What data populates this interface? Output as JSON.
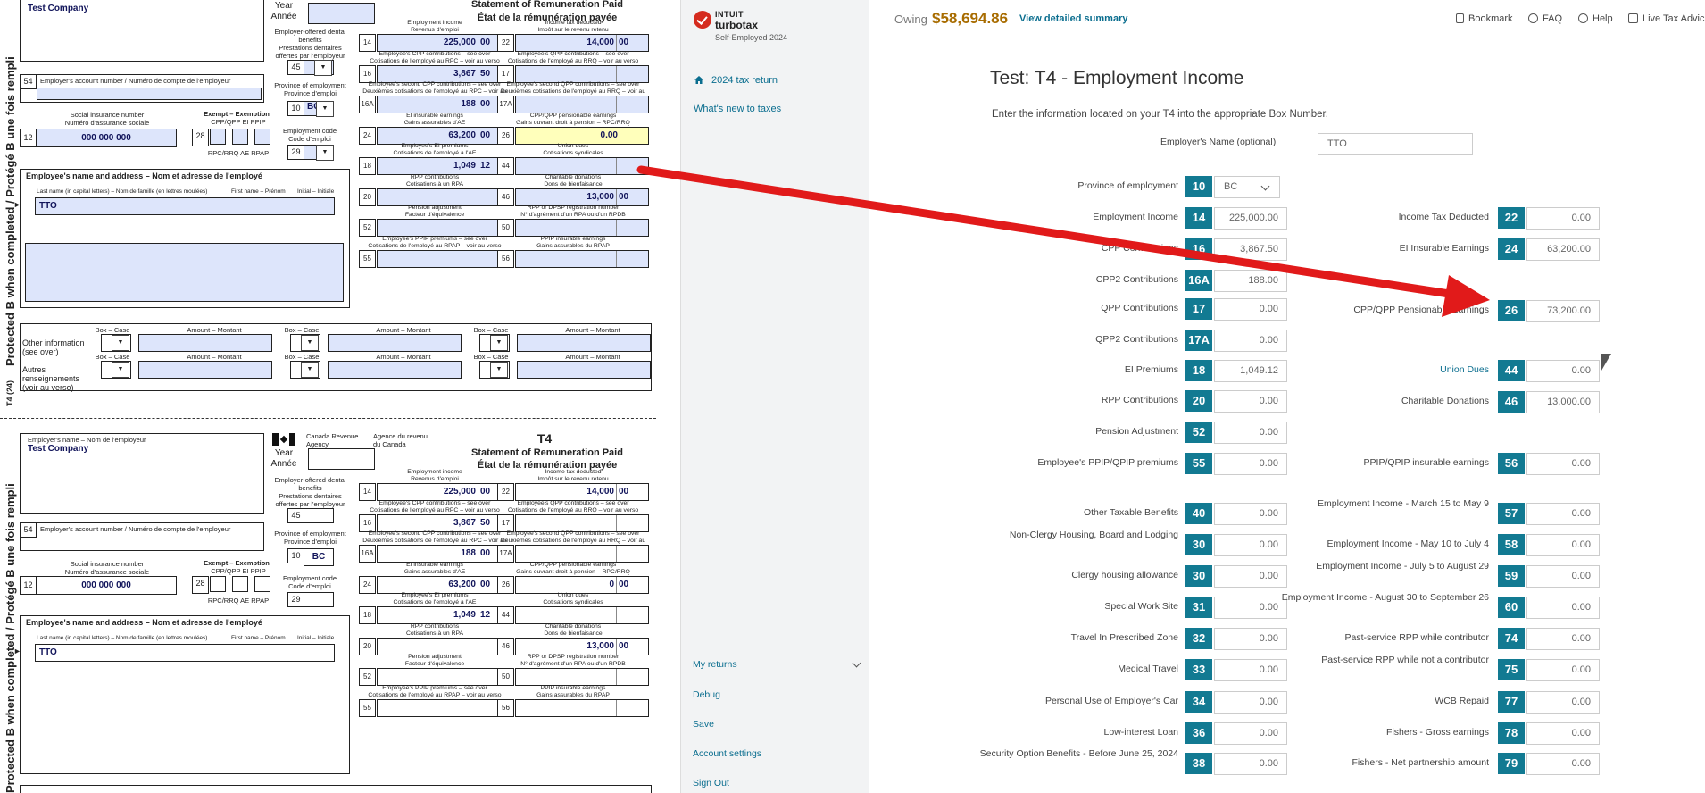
{
  "form": {
    "side_text_1": "Protected B when completed / Protégé B une fois rempli",
    "side_text_2": "T4 (24)",
    "side_text_3": "Protected B when completed / Protégé B une fois rempli",
    "employer_name": "Test Company",
    "employer_name_label": "Employer's name – Nom de l'employeur",
    "year_label": "Year\nAnnée",
    "statement_en": "Statement of Remuneration Paid",
    "statement_fr": "État de la rémunération payée",
    "cra_en": "Canada Revenue Agency",
    "cra_fr": "Agence du revenu du Canada",
    "t4": "T4",
    "dental_label": "Employer-offered dental benefits\nPrestations dentaires offertes par l'employeur",
    "box45": "45",
    "account_label": "Employer's account number / Numéro de compte de l'employeur",
    "box54": "54",
    "province_label": "Province of employment\nProvince d'emploi",
    "box10": "10",
    "province_value": "BC",
    "sin_label": "Social insurance number\nNuméro d'assurance sociale",
    "box12": "12",
    "sin_value": "000 000 000",
    "exempt_label": "Exempt – Exemption",
    "exempt_cols": "CPP/QPP   EI    PPIP",
    "exempt_cols_fr": "RPC/RRQ  AE   RPAP",
    "box28": "28",
    "empcode_label": "Employment code\nCode d'emploi",
    "box29": "29",
    "employee_label": "Employee's name and address – Nom et adresse de l'employé",
    "lastname_label": "Last name (in capital letters) – Nom de famille (en lettres moulées)",
    "firstname_label": "First name – Prénom",
    "initial_label": "Initial – Initiale",
    "employee_name": "TTO",
    "other_info_label": "Other information (see over)",
    "other_info_label_fr": "Autres renseignements (voir au verso)",
    "box_case": "Box – Case",
    "amount_label": "Amount – Montant",
    "boxes_left": [
      {
        "num": "14",
        "label": "Employment income\nRevenus d'emploi",
        "value": "225,000",
        "cents": "00"
      },
      {
        "num": "16",
        "label": "Employee's CPP contributions – see over\nCotisations de l'employé au RPC – voir au verso",
        "value": "3,867",
        "cents": "50"
      },
      {
        "num": "16A",
        "label": "Employee's second CPP contributions – see over\nDeuxièmes cotisations de l'employé au RPC – voir au verso",
        "value": "188",
        "cents": "00"
      },
      {
        "num": "24",
        "label": "EI insurable earnings\nGains assurables d'AE",
        "value": "63,200",
        "cents": "00"
      },
      {
        "num": "18",
        "label": "Employee's EI premiums\nCotisations de l'employé à l'AE",
        "value": "1,049",
        "cents": "12"
      },
      {
        "num": "20",
        "label": "RPP contributions\nCotisations à un RPA",
        "value": "",
        "cents": ""
      },
      {
        "num": "52",
        "label": "Pension adjustment\nFacteur d'équivalence",
        "value": "",
        "cents": ""
      },
      {
        "num": "55",
        "label": "Employee's PPIP premiums – see over\nCotisations de l'employé au RPAP – voir au verso",
        "value": "",
        "cents": ""
      }
    ],
    "boxes_right": [
      {
        "num": "22",
        "label": "Income tax deducted\nImpôt sur le revenu retenu",
        "value": "14,000",
        "cents": "00"
      },
      {
        "num": "17",
        "label": "Employee's QPP contributions – see over\nCotisations de l'employé au RRQ – voir au verso",
        "value": "",
        "cents": ""
      },
      {
        "num": "17A",
        "label": "Employee's second QPP contributions – see over\nDeuxièmes cotisations de l'employé au RRQ – voir au verso",
        "value": "",
        "cents": ""
      },
      {
        "num": "26",
        "label": "CPP/QPP pensionable earnings\nGains ouvrant droit à pension – RPC/RRQ",
        "value": "0",
        "cents": "00"
      },
      {
        "num": "44",
        "label": "Union dues\nCotisations syndicales",
        "value": "",
        "cents": ""
      },
      {
        "num": "46",
        "label": "Charitable donations\nDons de bienfaisance",
        "value": "13,000",
        "cents": "00"
      },
      {
        "num": "50",
        "label": "RPP or DPSP registration number\nN° d'agrément d'un RPA ou d'un RPDB",
        "value": "",
        "cents": ""
      },
      {
        "num": "56",
        "label": "PPIP insurable earnings\nGains assurables du RPAP",
        "value": "",
        "cents": ""
      }
    ],
    "box26_top_value": "0.00"
  },
  "nav": {
    "brand_small": "INTUIT",
    "brand": "turbotax",
    "edition": "Self-Employed 2024",
    "items": [
      "2024 tax return",
      "What's new to taxes"
    ],
    "bottom": [
      "My returns",
      "Debug",
      "Save",
      "Account settings",
      "Sign Out"
    ]
  },
  "topbar": {
    "owing_label": "Owing",
    "owing_value": "$58,694.86",
    "summary_link": "View detailed summary",
    "links": [
      "Bookmark",
      "FAQ",
      "Help",
      "Live Tax Advice"
    ]
  },
  "main": {
    "title": "Test: T4 - Employment Income",
    "intro": "Enter the information located on your T4 into the appropriate Box Number.",
    "employer_label": "Employer's Name (optional)",
    "employer_value": "TTO",
    "left_fields": [
      {
        "label": "Province of employment",
        "box": "10",
        "value": "BC"
      },
      {
        "label": "Employment Income",
        "box": "14",
        "value": "225,000.00"
      },
      {
        "label": "CPP Contributions",
        "box": "16",
        "value": "3,867.50"
      },
      {
        "label": "CPP2 Contributions",
        "box": "16A",
        "value": "188.00"
      },
      {
        "label": "QPP Contributions",
        "box": "17",
        "value": "0.00"
      },
      {
        "label": "QPP2 Contributions",
        "box": "17A",
        "value": "0.00"
      },
      {
        "label": "EI Premiums",
        "box": "18",
        "value": "1,049.12"
      },
      {
        "label": "RPP Contributions",
        "box": "20",
        "value": "0.00"
      },
      {
        "label": "Pension Adjustment",
        "box": "52",
        "value": "0.00"
      },
      {
        "label": "Employee's PPIP/QPIP premiums",
        "box": "55",
        "value": "0.00"
      },
      {
        "label": "Other Taxable Benefits",
        "box": "40",
        "value": "0.00"
      },
      {
        "label": "Non-Clergy Housing, Board and Lodging",
        "box": "30",
        "value": "0.00"
      },
      {
        "label": "Clergy housing allowance",
        "box": "30",
        "value": "0.00"
      },
      {
        "label": "Special Work Site",
        "box": "31",
        "value": "0.00"
      },
      {
        "label": "Travel In Prescribed Zone",
        "box": "32",
        "value": "0.00"
      },
      {
        "label": "Medical Travel",
        "box": "33",
        "value": "0.00"
      },
      {
        "label": "Personal Use of Employer's Car",
        "box": "34",
        "value": "0.00"
      },
      {
        "label": "Low-interest Loan",
        "box": "36",
        "value": "0.00"
      },
      {
        "label": "Security Option Benefits - Before June 25, 2024",
        "box": "38",
        "value": "0.00"
      }
    ],
    "right_fields": [
      {
        "label": "Income Tax Deducted",
        "box": "22",
        "value": "0.00"
      },
      {
        "label": "EI Insurable Earnings",
        "box": "24",
        "value": "63,200.00"
      },
      {
        "label": "CPP/QPP Pensionable Earnings",
        "box": "26",
        "value": "73,200.00"
      },
      {
        "label": "Union Dues",
        "box": "44",
        "value": "0.00"
      },
      {
        "label": "Charitable Donations",
        "box": "46",
        "value": "13,000.00"
      },
      {
        "label": "PPIP/QPIP insurable earnings",
        "box": "56",
        "value": "0.00"
      },
      {
        "label": "Employment Income - March 15 to May 9",
        "box": "57",
        "value": "0.00"
      },
      {
        "label": "Employment Income - May 10 to July 4",
        "box": "58",
        "value": "0.00"
      },
      {
        "label": "Employment Income - July 5 to August 29",
        "box": "59",
        "value": "0.00"
      },
      {
        "label": "Employment Income - August 30 to September 26",
        "box": "60",
        "value": "0.00"
      },
      {
        "label": "Past-service RPP while contributor",
        "box": "74",
        "value": "0.00"
      },
      {
        "label": "Past-service RPP while not a contributor",
        "box": "75",
        "value": "0.00"
      },
      {
        "label": "WCB Repaid",
        "box": "77",
        "value": "0.00"
      },
      {
        "label": "Fishers - Gross earnings",
        "box": "78",
        "value": "0.00"
      },
      {
        "label": "Fishers - Net partnership amount",
        "box": "79",
        "value": "0.00"
      }
    ]
  },
  "colors": {
    "accent": "#127a92",
    "link": "#0b6e8f",
    "owing": "#a86c00",
    "arrow": "#e11a1a",
    "form_fill": "#dde5fb",
    "highlight": "#ffffbb"
  }
}
